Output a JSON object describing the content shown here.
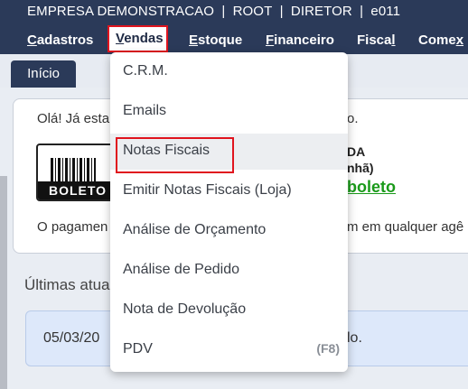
{
  "header": {
    "company": "EMPRESA DEMONSTRACAO",
    "sep1": "|",
    "user": "ROOT",
    "sep2": "|",
    "role": "DIRETOR",
    "sep3": "|",
    "code": "e011"
  },
  "menu": {
    "items": [
      {
        "first": "C",
        "rest": "adastros"
      },
      {
        "first": "V",
        "rest": "endas"
      },
      {
        "first": "E",
        "rest": "stoque"
      },
      {
        "first": "F",
        "rest": "inanceiro"
      },
      {
        "first": "Fisca",
        "rest": "l"
      },
      {
        "first": "Come",
        "rest": "x"
      }
    ]
  },
  "tabs": {
    "inicio": "Início"
  },
  "card": {
    "greeting_left": "Olá! Já esta",
    "greeting_right": "o.",
    "boleto_icon_text": "BOLETO",
    "strong_line1": "DA",
    "strong_line2": "nhã)",
    "boleto_link": "boleto",
    "payment_left": "O pagamen",
    "payment_right": "m em qualquer agê"
  },
  "updates": {
    "title": "Últimas atua",
    "item_date": "05/03/20",
    "item_end": "lo."
  },
  "dropdown": {
    "items": [
      {
        "label": "C.R.M.",
        "shortcut": ""
      },
      {
        "label": "Emails",
        "shortcut": ""
      },
      {
        "label": "Notas Fiscais",
        "shortcut": ""
      },
      {
        "label": "Emitir Notas Fiscais (Loja)",
        "shortcut": ""
      },
      {
        "label": "Análise de Orçamento",
        "shortcut": ""
      },
      {
        "label": "Análise de Pedido",
        "shortcut": ""
      },
      {
        "label": "Nota de Devolução",
        "shortcut": ""
      },
      {
        "label": "PDV",
        "shortcut": "(F8)"
      }
    ]
  },
  "colors": {
    "header_bg": "#2b3a59",
    "highlight_border": "#e0141e",
    "link_green": "#1a9a1a"
  }
}
